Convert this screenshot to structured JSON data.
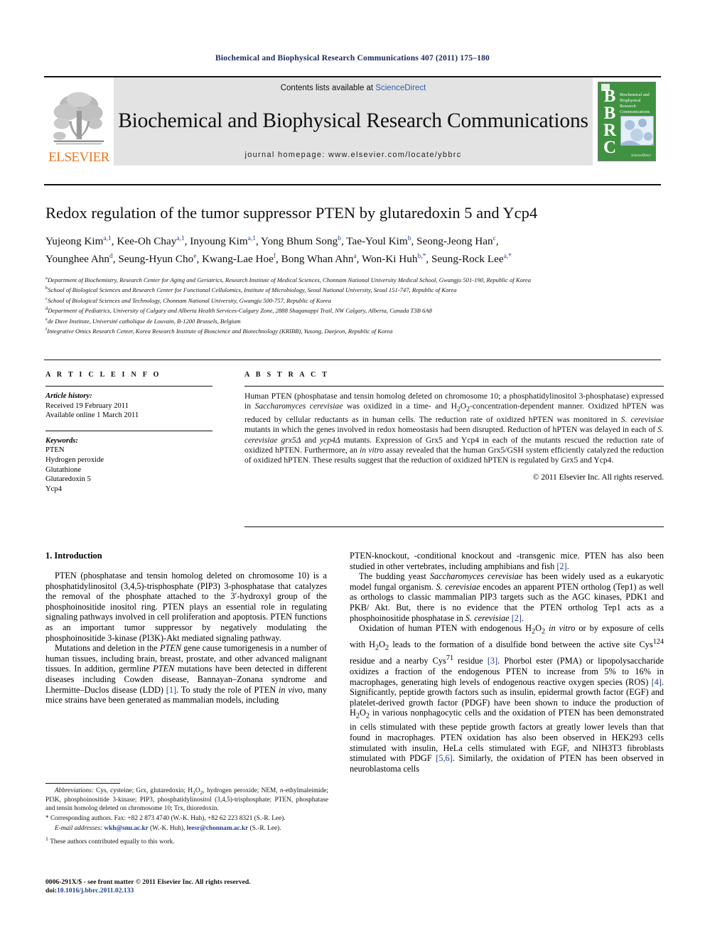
{
  "running_head": "Biochemical and Biophysical Research Communications 407 (2011) 175–180",
  "masthead": {
    "contents_prefix": "Contents lists available at ",
    "sciencedirect": "ScienceDirect",
    "journal_title": "Biochemical and Biophysical Research Communications",
    "homepage": "journal homepage: www.elsevier.com/locate/ybbrc",
    "elsevier_wordmark": "ELSEVIER",
    "cover": {
      "letters": "BBRC",
      "name": "Biochemical and Biophysical Research Communications",
      "publisher": "ScienceDirect"
    }
  },
  "article": {
    "title": "Redox regulation of the tumor suppressor PTEN by glutaredoxin 5 and Ycp4",
    "authors_line1": "Yujeong Kim a,1, Kee-Oh Chay a,1, Inyoung Kim a,1, Yong Bhum Song b, Tae-Youl Kim b, Seong-Jeong Han c,",
    "authors_line2": "Younghee Ahn d, Seung-Hyun Cho e, Kwang-Lae Hoe f, Bong Whan Ahn a, Won-Ki Huh b,*, Seung-Rock Lee a,*",
    "affiliations": [
      "Department of Biochemistry, Research Center for Aging and Geriatrics, Research Institute of Medical Sciences, Chonnam National University Medical School, Gwangju 501-190, Republic of Korea",
      "School of Biological Sciences and Research Center for Functional Cellulomics, Institute of Microbiology, Seoul National University, Seoul 151-747, Republic of Korea",
      "School of Biological Sciences and Technology, Chonnam National University, Gwangju 500-757, Republic of Korea",
      "Department of Pediatrics, University of Calgary and Alberta Health Services-Calgary Zone, 2888 Shaganappi Trail, NW Calgary, Alberta, Canada T3B 6A8",
      "de Duve Institute, Université catholique de Louvain, B-1200 Brussels, Belgium",
      "Integrative Omics Research Center, Korea Research Institute of Bioscience and Biotechnology (KRIBB), Yusong, Daejeon, Republic of Korea"
    ],
    "affiliation_markers": [
      "a",
      "b",
      "c",
      "d",
      "e",
      "f"
    ]
  },
  "article_info": {
    "heading": "A R T I C L E    I N F O",
    "history_label": "Article history:",
    "history": [
      "Received 19 February 2011",
      "Available online 1 March 2011"
    ],
    "keywords_label": "Keywords:",
    "keywords": [
      "PTEN",
      "Hydrogen peroxide",
      "Glutathione",
      "Glutaredoxin 5",
      "Ycp4"
    ]
  },
  "abstract": {
    "heading": "A B S T R A C T",
    "text": "Human PTEN (phosphatase and tensin homolog deleted on chromosome 10; a phosphatidylinositol 3-phosphatase) expressed in Saccharomyces cerevisiae was oxidized in a time- and H2O2-concentration-dependent manner. Oxidized hPTEN was reduced by cellular reductants as in human cells. The reduction rate of oxidized hPTEN was monitored in S. cerevisiae mutants in which the genes involved in redox homeostasis had been disrupted. Reduction of hPTEN was delayed in each of S. cerevisiae grx5Δ and ycp4Δ mutants. Expression of Grx5 and Ycp4 in each of the mutants rescued the reduction rate of oxidized hPTEN. Furthermore, an in vitro assay revealed that the human Grx5/GSH system efficiently catalyzed the reduction of oxidized hPTEN. These results suggest that the reduction of oxidized hPTEN is regulated by Grx5 and Ycp4.",
    "copyright": "© 2011 Elsevier Inc. All rights reserved."
  },
  "body": {
    "section_heading": "1. Introduction",
    "left_paragraphs": [
      "PTEN (phosphatase and tensin homolog deleted on chromosome 10) is a phosphatidylinositol (3,4,5)-trisphosphate (PIP3) 3-phosphatase that catalyzes the removal of the phosphate attached to the 3′-hydroxyl group of the phosphoinositide inositol ring. PTEN plays an essential role in regulating signaling pathways involved in cell proliferation and apoptosis. PTEN functions as an important tumor suppressor by negatively modulating the phosphoinositide 3-kinase (PI3K)-Akt mediated signaling pathway.",
      "Mutations and deletion in the PTEN gene cause tumorigenesis in a number of human tissues, including brain, breast, prostate, and other advanced malignant tissues. In addition, germline PTEN mutations have been detected in different diseases including Cowden disease, Bannayan–Zonana syndrome and Lhermitte–Duclos disease (LDD) [1]. To study the role of PTEN in vivo, many mice strains have been generated as mammalian models, including"
    ],
    "right_paragraphs": [
      "PTEN-knockout, -conditional knockout and -transgenic mice. PTEN has also been studied in other vertebrates, including amphibians and fish [2].",
      "The budding yeast Saccharomyces cerevisiae has been widely used as a eukaryotic model fungal organism. S. cerevisiae encodes an apparent PTEN ortholog (Tep1) as well as orthologs to classic mammalian PIP3 targets such as the AGC kinases, PDK1 and PKB/Akt. But, there is no evidence that the PTEN ortholog Tep1 acts as a phosphoinositide phosphatase in S. cerevisiae [2].",
      "Oxidation of human PTEN with endogenous H2O2 in vitro or by exposure of cells with H2O2 leads to the formation of a disulfide bond between the active site Cys124 residue and a nearby Cys71 residue [3]. Phorbol ester (PMA) or lipopolysaccharide oxidizes a fraction of the endogenous PTEN to increase from 5% to 16% in macrophages, generating high levels of endogenous reactive oxygen species (ROS) [4]. Significantly, peptide growth factors such as insulin, epidermal growth factor (EGF) and platelet-derived growth factor (PDGF) have been shown to induce the production of H2O2 in various nonphagocytic cells and the oxidation of PTEN has been demonstrated in cells stimulated with these peptide growth factors at greatly lower levels than that found in macrophages. PTEN oxidation has also been observed in HEK293 cells stimulated with insulin, HeLa cells stimulated with EGF, and NIH3T3 fibroblasts stimulated with PDGF [5,6]. Similarly, the oxidation of PTEN has been observed in neuroblastoma cells"
    ]
  },
  "footnotes": {
    "abbreviations_label": "Abbreviations:",
    "abbreviations_text": "Cys, cysteine; Grx, glutaredoxin; H2O2, hydrogen peroxide; NEM, n-ethylmaleimide; PI3K, phosphoinositide 3-kinase; PIP3, phosphatidylinositol (3,4,5)-trisphosphate; PTEN, phosphatase and tensin homolog deleted on chromosome 10; Trx, thioredoxin.",
    "corresponding": "* Corresponding authors. Fax: +82 2 873 4740 (W.-K. Huh), +82 62 223 8321 (S.-R. Lee).",
    "email_label": "E-mail addresses:",
    "email_1": "wkh@snu.ac.kr",
    "email_1_person": "(W.-K. Huh),",
    "email_2": "leesr@chonnam.ac.kr",
    "email_2_person": "(S.-R. Lee).",
    "equal_contrib": "1  These authors contributed equally to this work."
  },
  "footer": {
    "issn_line": "0006-291X/$ - see front matter © 2011 Elsevier Inc. All rights reserved.",
    "doi_label": "doi:",
    "doi_value": "10.1016/j.bbrc.2011.02.133"
  },
  "colors": {
    "link_blue": "#1f3d8f",
    "sciencedirect_blue": "#2b5faa",
    "elsevier_orange": "#E87722",
    "cover_green": "#3f9240",
    "masthead_gray": "#e3e3e3"
  }
}
